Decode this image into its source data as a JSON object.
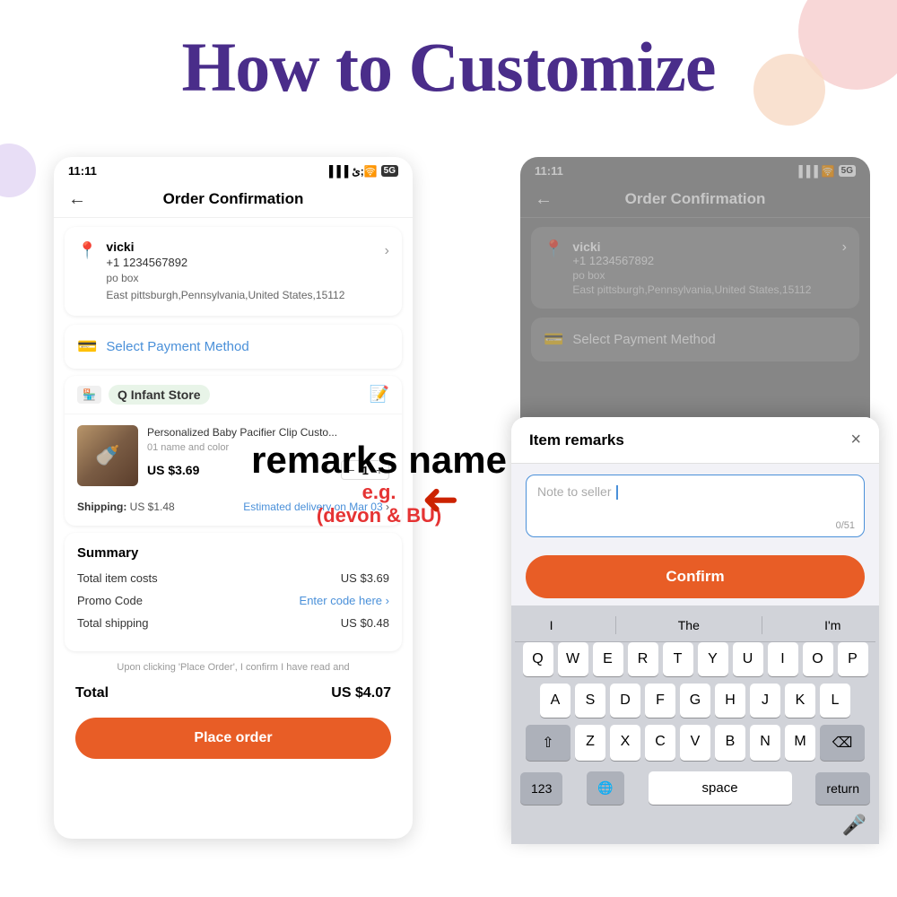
{
  "page": {
    "title": "How to Customize",
    "background": "#ffffff"
  },
  "left_phone": {
    "status_time": "11:11",
    "header_title": "Order Confirmation",
    "address": {
      "name": "vicki",
      "phone": "+1 1234567892",
      "po_box": "po box",
      "city": "East pittsburgh,Pennsylvania,United States,15112"
    },
    "payment": {
      "label": "Select Payment Method"
    },
    "store": {
      "name": "Q Infant Store"
    },
    "product": {
      "title": "Personalized Baby Pacifier Clip Custo...",
      "variant": "01 name and color",
      "price": "US $3.69",
      "quantity": "1"
    },
    "shipping": {
      "label": "Shipping:",
      "price": "US $1.48",
      "delivery": "Estimated delivery on Mar 03"
    },
    "summary": {
      "title": "Summary",
      "item_costs_label": "Total item costs",
      "item_costs_value": "US $3.69",
      "promo_label": "Promo Code",
      "promo_value": "Enter code here",
      "shipping_label": "Total shipping",
      "shipping_value": "US $0.48"
    },
    "disclaimer": "Upon clicking 'Place Order', I confirm I have read and",
    "total_label": "Total",
    "total_value": "US $4.07",
    "place_order": "Place order"
  },
  "right_phone": {
    "status_time": "11:11",
    "header_title": "Order Confirmation",
    "address": {
      "name": "vicki",
      "phone": "+1 1234567892",
      "po_box": "po box",
      "city": "East pittsburgh,Pennsylvania,United States,15112"
    },
    "payment": {
      "label": "Select Payment Method"
    }
  },
  "modal": {
    "title": "Item remarks",
    "close_icon": "×",
    "input_placeholder": "Note to seller",
    "char_count": "0/51",
    "confirm_label": "Confirm"
  },
  "annotation": {
    "line1": "remarks name",
    "line2": "e.g.",
    "line3": "(devon & BU)"
  },
  "keyboard": {
    "suggestions": [
      "I",
      "The",
      "I'm"
    ],
    "row1": [
      "Q",
      "W",
      "E",
      "R",
      "T",
      "Y",
      "U",
      "I",
      "O",
      "P"
    ],
    "row2": [
      "A",
      "S",
      "D",
      "F",
      "G",
      "H",
      "J",
      "K",
      "L"
    ],
    "row3": [
      "Z",
      "X",
      "C",
      "V",
      "B",
      "N",
      "M"
    ],
    "bottom": {
      "numbers": "123",
      "emoji": "🙂",
      "space": "space",
      "return": "return",
      "globe": "🌐",
      "mic": "🎤"
    }
  }
}
